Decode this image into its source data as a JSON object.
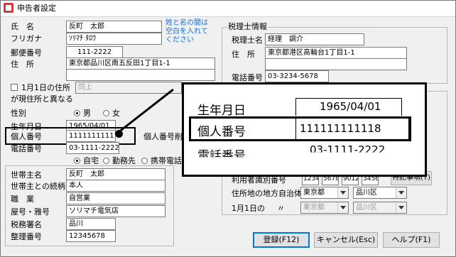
{
  "window": {
    "title": "申告者設定"
  },
  "personal": {
    "name_label": "氏　名",
    "name_value": "反町　太郎",
    "name_note": "姓と名の間は空白を入れてください",
    "furigana_label": "フリガナ",
    "furigana_value": "ｿﾘﾏﾁ ﾀﾛｳ",
    "zip_label": "郵便番号",
    "zip_value": "111-2222",
    "address_label": "住　所",
    "address_value": "東京都品川区南五反田1丁目1-1",
    "jan1_check_label": "1月1日の住所",
    "jan1_value": "同上",
    "jan1_line2": "が現住所と異なる",
    "gender_label": "性別",
    "gender_male": "男",
    "gender_female": "女",
    "birth_label": "生年月日",
    "birth_value": "1965/04/01",
    "mynumber_label": "個人番号",
    "mynumber_value": "111111111118",
    "mynumber_delete": "個人番号削除",
    "phone_label": "電話番号",
    "phone_value": "03-1111-2222",
    "phone_home": "自宅",
    "phone_work": "勤務先",
    "phone_mobile": "携帯電話"
  },
  "household": {
    "head_label": "世帯主名",
    "head_value": "反町　太郎",
    "relation_label": "世帯主との続柄",
    "relation_value": "本人",
    "occupation_label": "職　業",
    "occupation_value": "自営業",
    "shop_label": "屋号・雅号",
    "shop_value": "ソリマチ電気店",
    "taxoffice_label": "税務署名",
    "taxoffice_value": "品川",
    "ref_label": "整理番号",
    "ref_value": "12345678"
  },
  "accountant": {
    "group_title": "税理士情報",
    "name_label": "税理士名",
    "name_value": "経理　調介",
    "address_label": "住　所",
    "address_value": "東京都港区高輪台1丁目1-1",
    "phone_label": "電話番号",
    "phone_value": "03-3234-5678"
  },
  "local_tax": {
    "user_id_label": "利用者識別番号",
    "user_id_parts": [
      "1234",
      "5678",
      "9012",
      "3456"
    ],
    "special_button": "特記事項(T)",
    "current_label": "住所地の地方自治体",
    "current_pref": "東京都",
    "current_city": "品川区",
    "jan1_label": "1月1日の",
    "jan1_ditto": "〃",
    "jan1_pref": "東京都",
    "jan1_city": "品川区"
  },
  "buttons": {
    "register": "登録(F12)",
    "cancel": "キャンセル(Esc)",
    "help": "ヘルプ(F1)"
  },
  "zoom": {
    "birth_label": "生年月日",
    "birth_value": "1965/04/01",
    "mynumber_label": "個人番号",
    "mynumber_value": "111111111118",
    "phone_label": "電話番号",
    "phone_value": "03-1111-2222"
  },
  "colors": {
    "note_blue": "#1a6fd6",
    "accent": "#0078d7"
  }
}
